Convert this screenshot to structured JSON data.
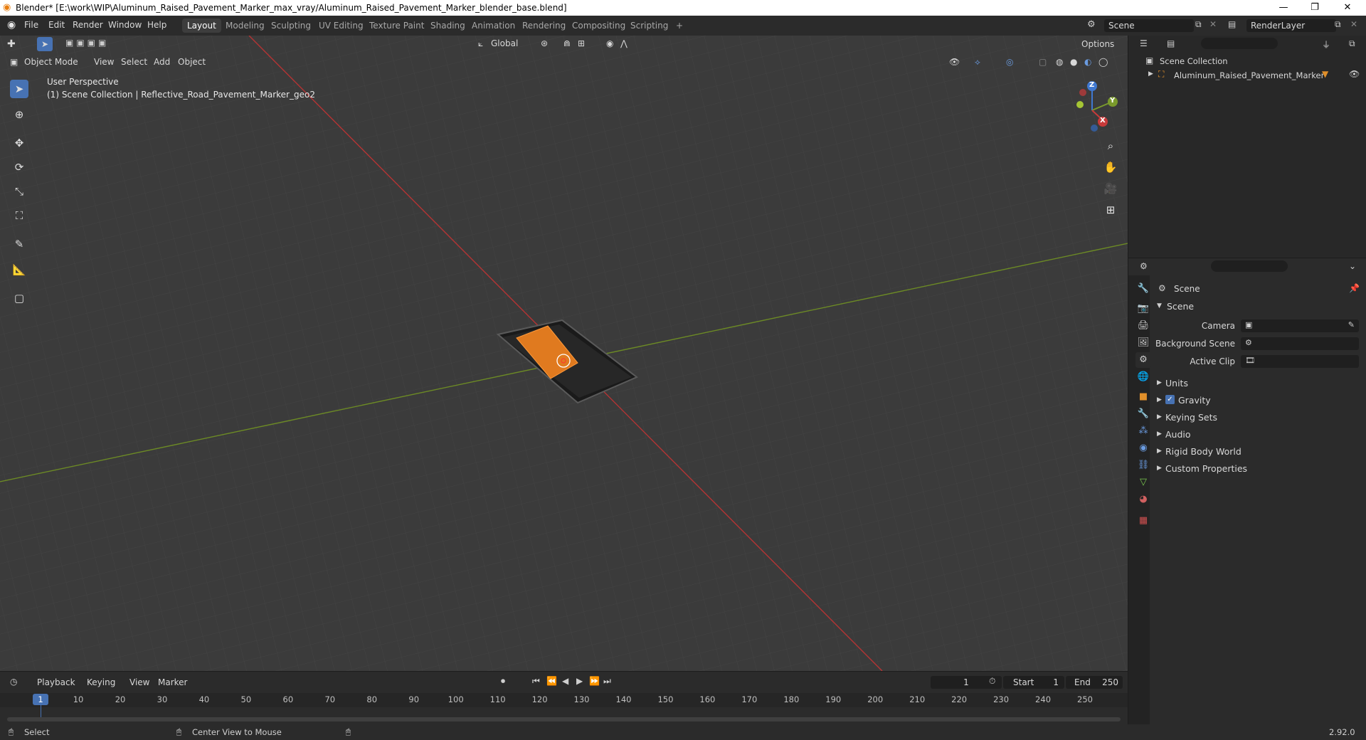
{
  "window": {
    "title": "Blender* [E:\\work\\WIP\\Aluminum_Raised_Pavement_Marker_max_vray/Aluminum_Raised_Pavement_Marker_blender_base.blend]",
    "minimize": "—",
    "restore": "❐",
    "close": "✕"
  },
  "menu": [
    "File",
    "Edit",
    "Render",
    "Window",
    "Help"
  ],
  "workspaces": [
    "Layout",
    "Modeling",
    "Sculpting",
    "UV Editing",
    "Texture Paint",
    "Shading",
    "Animation",
    "Rendering",
    "Compositing",
    "Scripting"
  ],
  "add_workspace": "+",
  "scene_field": "Scene",
  "renderlayer_field": "RenderLayer",
  "toolbar": {
    "orientation": "Global",
    "options": "Options"
  },
  "viewport": {
    "mode": "Object Mode",
    "menus": [
      "View",
      "Select",
      "Add",
      "Object"
    ],
    "overlay_line1": "User Perspective",
    "overlay_line2": "(1) Scene Collection | Reflective_Road_Pavement_Marker_geo2",
    "axes": {
      "x": "X",
      "y": "Y",
      "z": "Z"
    }
  },
  "outliner": {
    "root": "Scene Collection",
    "item": "Aluminum_Raised_Pavement_Marker"
  },
  "properties": {
    "context_title": "Scene",
    "section": "Scene",
    "camera_label": "Camera",
    "background_scene_label": "Background Scene",
    "active_clip_label": "Active Clip",
    "panels": [
      "Units",
      "Gravity",
      "Keying Sets",
      "Audio",
      "Rigid Body World",
      "Custom Properties"
    ]
  },
  "timeline": {
    "menus": [
      "Playback",
      "Keying",
      "View",
      "Marker"
    ],
    "current_frame": "1",
    "start_label": "Start",
    "start": "1",
    "end_label": "End",
    "end": "250",
    "ticks": [
      "10",
      "20",
      "30",
      "40",
      "50",
      "60",
      "70",
      "80",
      "90",
      "100",
      "110",
      "120",
      "130",
      "140",
      "150",
      "160",
      "170",
      "180",
      "190",
      "200",
      "210",
      "220",
      "230",
      "240",
      "250"
    ]
  },
  "status": {
    "left": "Select",
    "middle": "Center View to Mouse",
    "version": "2.92.0"
  },
  "colors": {
    "accent": "#4772b3",
    "x_axis": "#c83a3a",
    "y_axis": "#7a9a2c",
    "marker": "#e07a1f"
  }
}
